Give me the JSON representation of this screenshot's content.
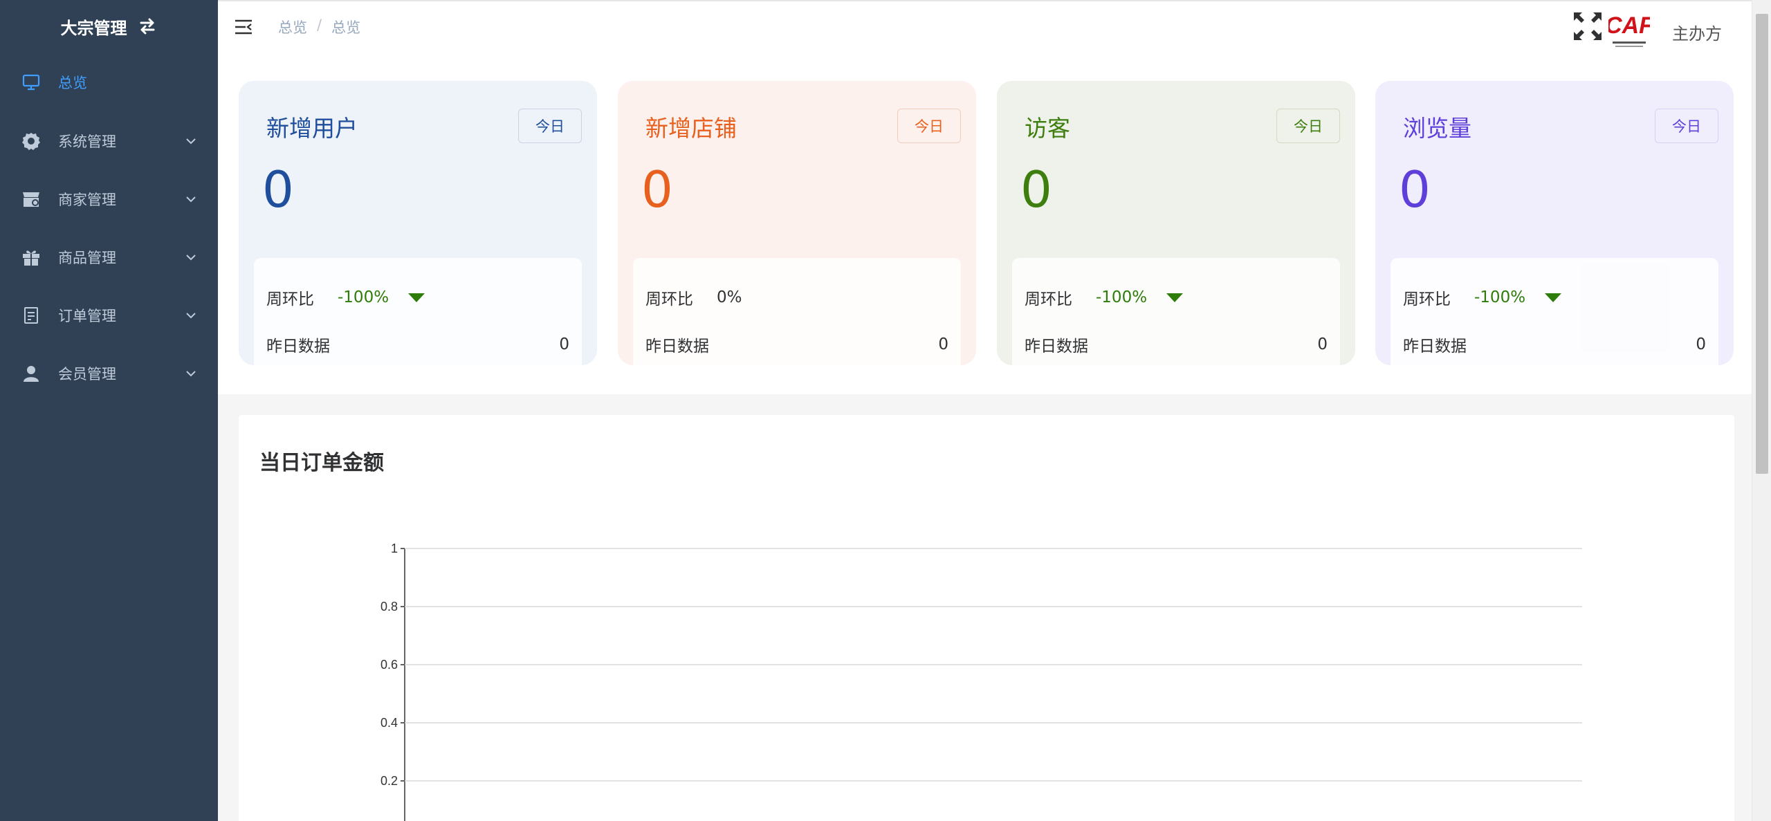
{
  "sidebar": {
    "title": "大宗管理",
    "items": [
      {
        "label": "总览",
        "icon": "monitor-icon",
        "active": true
      },
      {
        "label": "系统管理",
        "icon": "gear-icon"
      },
      {
        "label": "商家管理",
        "icon": "store-icon"
      },
      {
        "label": "商品管理",
        "icon": "gift-icon"
      },
      {
        "label": "订单管理",
        "icon": "document-icon"
      },
      {
        "label": "会员管理",
        "icon": "user-icon"
      }
    ]
  },
  "header": {
    "breadcrumb": [
      "总览",
      "总览"
    ],
    "organizer": "主办方",
    "logo_text": "CAF"
  },
  "cards": [
    {
      "title": "新增用户",
      "button": "今日",
      "value": "0",
      "wow_label": "周环比",
      "wow_value": "-100%",
      "wow_down": true,
      "yesterday_label": "昨日数据",
      "yesterday_value": "0",
      "color": "#1f4e9c"
    },
    {
      "title": "新增店铺",
      "button": "今日",
      "value": "0",
      "wow_label": "周环比",
      "wow_value": "0%",
      "wow_down": false,
      "yesterday_label": "昨日数据",
      "yesterday_value": "0",
      "color": "#e8601e"
    },
    {
      "title": "访客",
      "button": "今日",
      "value": "0",
      "wow_label": "周环比",
      "wow_value": "-100%",
      "wow_down": true,
      "yesterday_label": "昨日数据",
      "yesterday_value": "0",
      "color": "#3e7e0f"
    },
    {
      "title": "浏览量",
      "button": "今日",
      "value": "0",
      "wow_label": "周环比",
      "wow_value": "-100%",
      "wow_down": true,
      "yesterday_label": "昨日数据",
      "yesterday_value": "0",
      "color": "#5e3fd9"
    }
  ],
  "chart_panel": {
    "title": "当日订单金额"
  },
  "chart_data": {
    "type": "line",
    "title": "当日订单金额",
    "yticks": [
      "1",
      "0.8",
      "0.6",
      "0.4",
      "0.2"
    ],
    "ylim": [
      0,
      1
    ],
    "grid": true,
    "series": []
  }
}
